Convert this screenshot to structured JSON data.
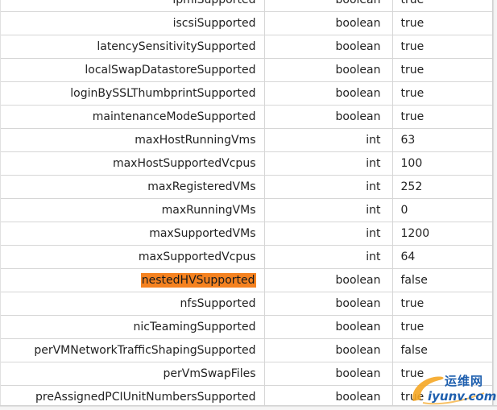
{
  "properties": [
    {
      "name": "ipmiSupported",
      "type": "boolean",
      "value": "true"
    },
    {
      "name": "iscsiSupported",
      "type": "boolean",
      "value": "true"
    },
    {
      "name": "latencySensitivitySupported",
      "type": "boolean",
      "value": "true"
    },
    {
      "name": "localSwapDatastoreSupported",
      "type": "boolean",
      "value": "true"
    },
    {
      "name": "loginBySSLThumbprintSupported",
      "type": "boolean",
      "value": "true"
    },
    {
      "name": "maintenanceModeSupported",
      "type": "boolean",
      "value": "true"
    },
    {
      "name": "maxHostRunningVms",
      "type": "int",
      "value": "63"
    },
    {
      "name": "maxHostSupportedVcpus",
      "type": "int",
      "value": "100"
    },
    {
      "name": "maxRegisteredVMs",
      "type": "int",
      "value": "252"
    },
    {
      "name": "maxRunningVMs",
      "type": "int",
      "value": "0"
    },
    {
      "name": "maxSupportedVMs",
      "type": "int",
      "value": "1200"
    },
    {
      "name": "maxSupportedVcpus",
      "type": "int",
      "value": "64"
    },
    {
      "name": "nestedHVSupported",
      "type": "boolean",
      "value": "false"
    },
    {
      "name": "nfsSupported",
      "type": "boolean",
      "value": "true"
    },
    {
      "name": "nicTeamingSupported",
      "type": "boolean",
      "value": "true"
    },
    {
      "name": "perVMNetworkTrafficShapingSupported",
      "type": "boolean",
      "value": "false"
    },
    {
      "name": "perVmSwapFiles",
      "type": "boolean",
      "value": "true"
    },
    {
      "name": "preAssignedPCIUnitNumbersSupported",
      "type": "boolean",
      "value": "true"
    }
  ],
  "highlight": {
    "row_name": "nestedHVSupported",
    "color": "#f58220"
  },
  "watermark": {
    "cn_text": "运维网",
    "en_text": "iyunv.com",
    "color": "#1e5fae",
    "swoosh_color": "#f5a623"
  },
  "colors": {
    "grid_line": "#d6d6d6",
    "text": "#222222"
  }
}
